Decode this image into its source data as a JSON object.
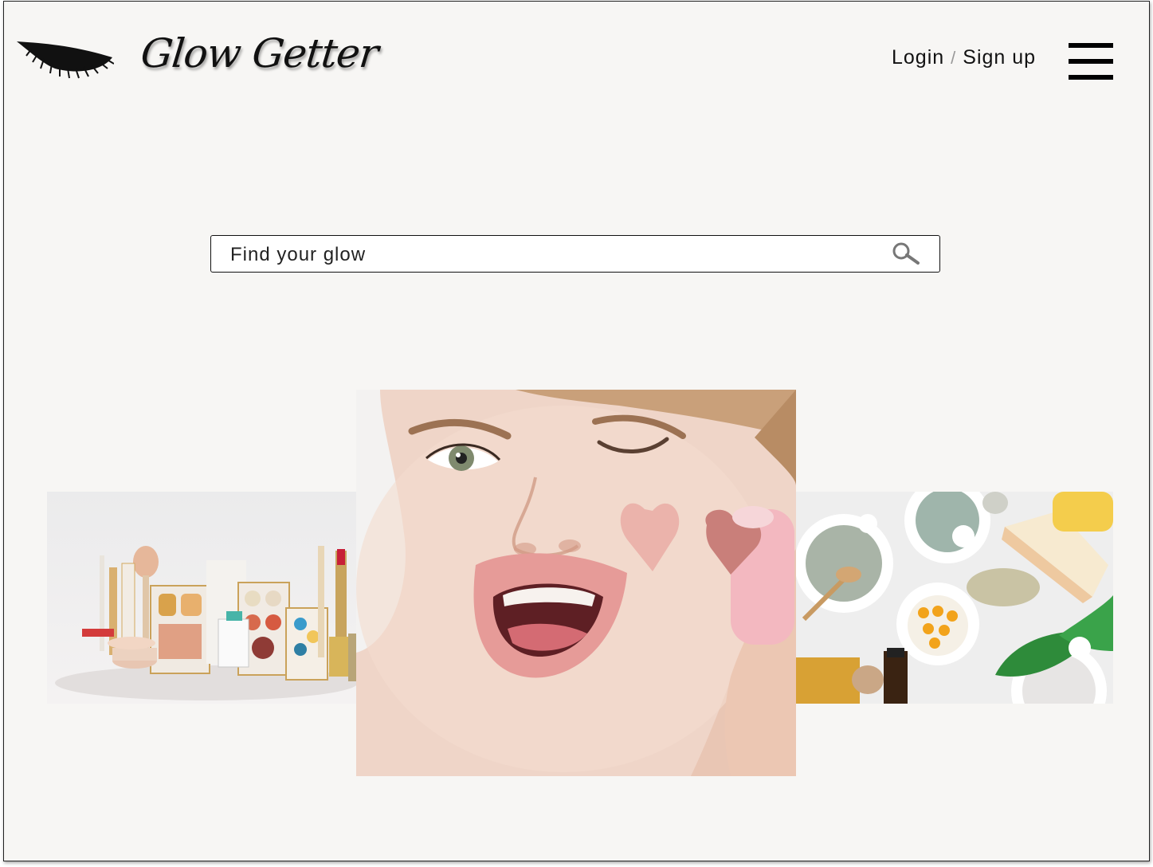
{
  "header": {
    "brand": "Glow Getter",
    "login_label": "Login",
    "separator": "/",
    "signup_label": "Sign up"
  },
  "search": {
    "placeholder": "Find your glow"
  },
  "gallery": {
    "images": [
      "makeup-products-photo",
      "woman-winking-blush-photo",
      "natural-skincare-ingredients-photo"
    ]
  },
  "colors": {
    "background": "#f7f6f4",
    "text": "#111111"
  }
}
